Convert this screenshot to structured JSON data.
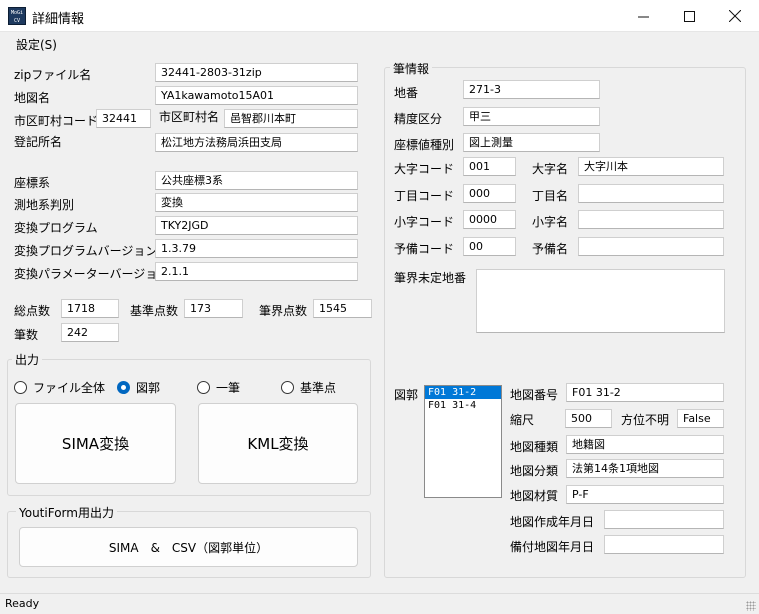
{
  "window": {
    "title": "詳細情報",
    "icon": "app-icon",
    "icon_text": "MoGi CV"
  },
  "menu": {
    "settings": "設定(S)"
  },
  "left": {
    "zip_label": "zipファイル名",
    "zip_value": "32441-2803-31zip",
    "map_label": "地図名",
    "map_value": "YA1kawamoto15A01",
    "city_code_label": "市区町村コード",
    "city_code_value": "32441",
    "city_name_label": "市区町村名",
    "city_name_value": "邑智郡川本町",
    "office_label": "登記所名",
    "office_value": "松江地方法務局浜田支局",
    "coord_label": "座標系",
    "coord_value": "公共座標3系",
    "geodetic_label": "測地系判別",
    "geodetic_value": "変換",
    "program_label": "変換プログラム",
    "program_value": "TKY2JGD",
    "program_ver_label": "変換プログラムバージョン",
    "program_ver_value": "1.3.79",
    "param_ver_label": "変換パラメーターバージョン",
    "param_ver_value": "2.1.1",
    "total_points_label": "総点数",
    "total_points_value": "1718",
    "base_points_label": "基準点数",
    "base_points_value": "173",
    "boundary_points_label": "筆界点数",
    "boundary_points_value": "1545",
    "parcels_label": "筆数",
    "parcels_value": "242"
  },
  "output": {
    "title": "出力",
    "radio_all": "ファイル全体",
    "radio_zukaku": "図郭",
    "radio_ippitsu": "一筆",
    "radio_base": "基準点",
    "selected": "図郭",
    "sima_button": "SIMA変換",
    "kml_button": "KML変換"
  },
  "youti": {
    "title": "YoutiForm用出力",
    "button": "SIMA　&　CSV（図郭単位）"
  },
  "parcel": {
    "title": "筆情報",
    "chiban_label": "地番",
    "chiban_value": "271-3",
    "accuracy_label": "精度区分",
    "accuracy_value": "甲三",
    "coord_type_label": "座標値種別",
    "coord_type_value": "図上測量",
    "oaza_code_label": "大字コード",
    "oaza_code_value": "001",
    "oaza_name_label": "大字名",
    "oaza_name_value": "大字川本",
    "chome_code_label": "丁目コード",
    "chome_code_value": "000",
    "chome_name_label": "丁目名",
    "chome_name_value": "",
    "koaza_code_label": "小字コード",
    "koaza_code_value": "0000",
    "koaza_name_label": "小字名",
    "koaza_name_value": "",
    "yobi_code_label": "予備コード",
    "yobi_code_value": "00",
    "yobi_name_label": "予備名",
    "yobi_name_value": "",
    "undetermined_label": "筆界未定地番",
    "undetermined_value": ""
  },
  "zukaku": {
    "label": "図郭",
    "list": [
      "F01 31-2",
      "F01 31-4"
    ],
    "selected_index": 0,
    "map_no_label": "地図番号",
    "map_no_value": "F01 31-2",
    "scale_label": "縮尺",
    "scale_value": "500",
    "orientation_label": "方位不明",
    "orientation_value": "False",
    "map_type_label": "地図種類",
    "map_type_value": "地籍図",
    "map_class_label": "地図分類",
    "map_class_value": "法第14条1項地図",
    "material_label": "地図材質",
    "material_value": "P-F",
    "created_label": "地図作成年月日",
    "created_value": "",
    "attached_label": "備付地図年月日",
    "attached_value": ""
  },
  "status": {
    "text": "Ready"
  }
}
